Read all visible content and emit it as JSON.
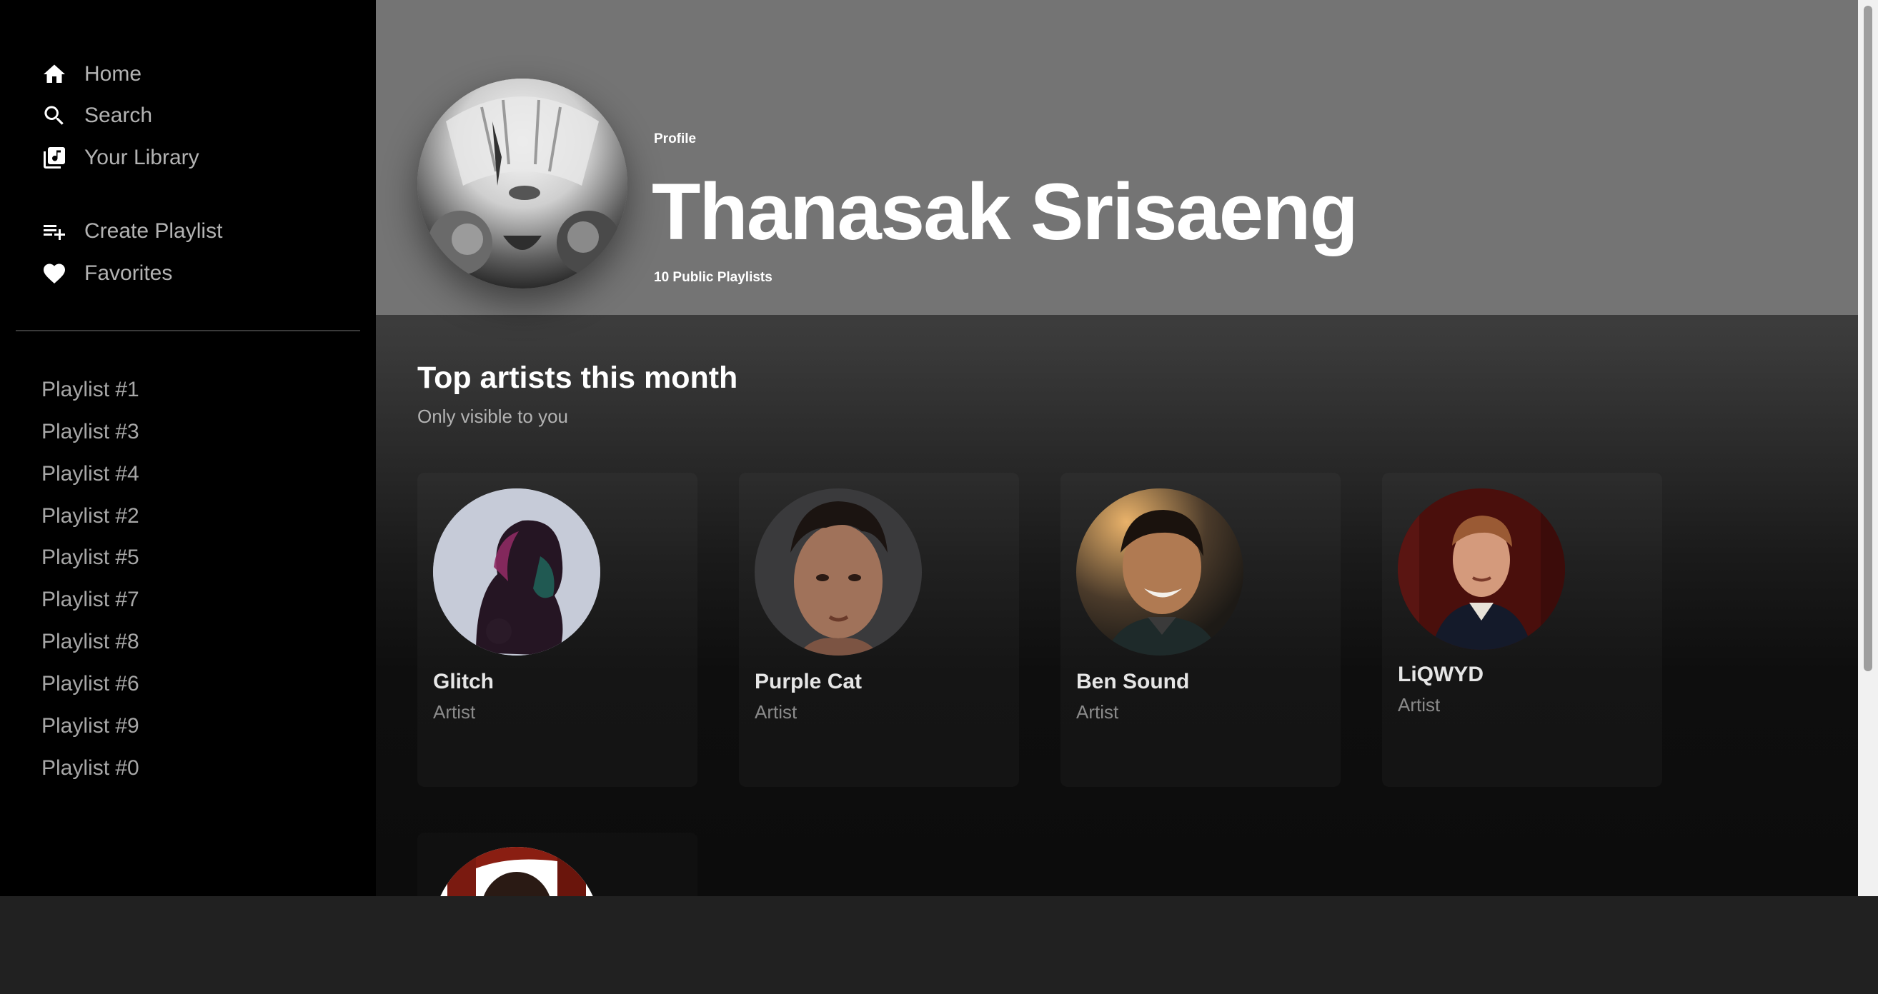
{
  "sidebar": {
    "nav": [
      {
        "label": "Home",
        "icon": "home-icon"
      },
      {
        "label": "Search",
        "icon": "search-icon"
      },
      {
        "label": "Your Library",
        "icon": "library-icon"
      }
    ],
    "actions": [
      {
        "label": "Create Playlist",
        "icon": "playlist-add-icon"
      },
      {
        "label": "Favorites",
        "icon": "heart-icon"
      }
    ],
    "playlists": [
      "Playlist #1",
      "Playlist #3",
      "Playlist #4",
      "Playlist #2",
      "Playlist #5",
      "Playlist #7",
      "Playlist #8",
      "Playlist #6",
      "Playlist #9",
      "Playlist #0"
    ]
  },
  "profile": {
    "label": "Profile",
    "name": "Thanasak Srisaeng",
    "subtitle": "10 Public Playlists"
  },
  "top_artists": {
    "title": "Top artists this month",
    "subtitle": "Only visible to you",
    "artists": [
      {
        "name": "Glitch",
        "role": "Artist"
      },
      {
        "name": "Purple Cat",
        "role": "Artist"
      },
      {
        "name": "Ben Sound",
        "role": "Artist"
      },
      {
        "name": "LiQWYD",
        "role": "Artist"
      }
    ]
  },
  "colors": {
    "sidebar_bg": "#000000",
    "header_bg": "#747474",
    "player_bar_bg": "#212121",
    "text_primary": "#ffffff",
    "text_muted": "#b3b3b3"
  }
}
